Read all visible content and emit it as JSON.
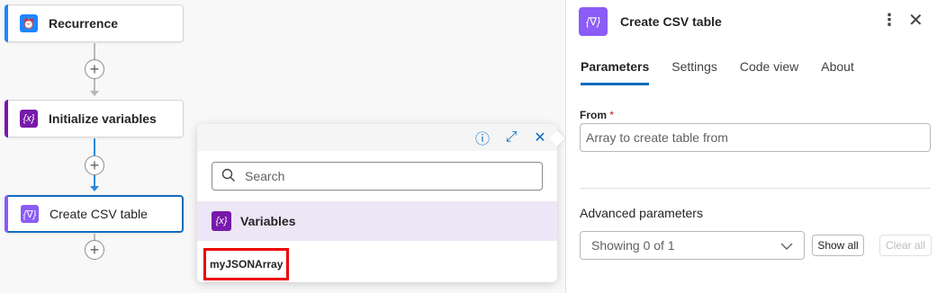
{
  "canvas": {
    "cards": [
      {
        "label": "Recurrence",
        "icon": "alarm-clock-icon",
        "color": "#1f85ff"
      },
      {
        "label": "Initialize variables",
        "icon": "variable-icon",
        "color": "#7719aa"
      },
      {
        "label": "Create CSV table",
        "icon": "data-operation-icon",
        "color": "#8b5cf6"
      }
    ]
  },
  "popup": {
    "search_placeholder": "Search",
    "section_label": "Variables",
    "items": [
      {
        "label": "myJSONArray"
      }
    ],
    "icons": [
      "info-icon",
      "expand-icon",
      "close-icon"
    ]
  },
  "panel": {
    "title": "Create CSV table",
    "tabs": [
      {
        "label": "Parameters",
        "active": true
      },
      {
        "label": "Settings",
        "active": false
      },
      {
        "label": "Code view",
        "active": false
      },
      {
        "label": "About",
        "active": false
      }
    ],
    "from_label": "From",
    "from_required": "*",
    "from_placeholder": "Array to create table from",
    "advanced_label": "Advanced parameters",
    "advanced_select_value": "Showing 0 of 1",
    "show_all_label": "Show all",
    "clear_all_label": "Clear all"
  },
  "colors": {
    "accent": "#0f6cbd",
    "highlight_border": "#e00000"
  }
}
